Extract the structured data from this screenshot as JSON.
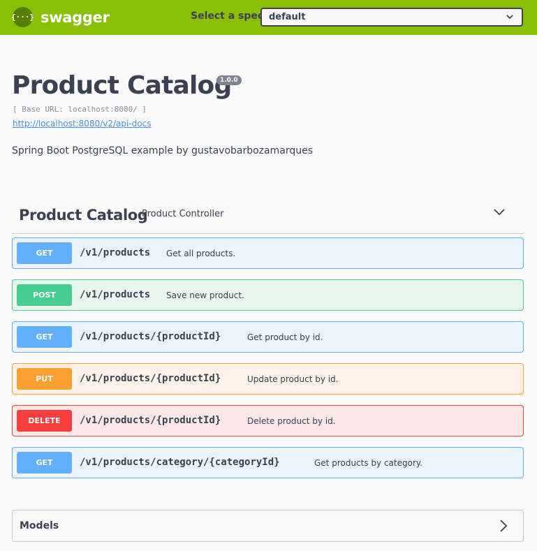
{
  "topbar": {
    "logo_symbol": "{···}",
    "logo_text": "swagger",
    "spec_label": "Select a spec",
    "spec_selected": "default",
    "background_color": "#89bf04"
  },
  "info": {
    "title": "Product Catalog",
    "version": "1.0.0",
    "base_url": "[ Base URL: localhost:8080/ ]",
    "docs_link": "http://localhost:8080/v2/api-docs",
    "description": "Spring Boot PostgreSQL example by gustavobarbozamarques"
  },
  "tag": {
    "name": "Product Catalog",
    "description": "Product Controller",
    "chevron_icon": "chevron-down-icon"
  },
  "operations": [
    {
      "method": "GET",
      "path": "/v1/products",
      "summary": "Get all products.",
      "color": "#61affe"
    },
    {
      "method": "POST",
      "path": "/v1/products",
      "summary": "Save new product.",
      "color": "#49cc90"
    },
    {
      "method": "GET",
      "path": "/v1/products/{productId}",
      "summary": "Get product by id.",
      "color": "#61affe"
    },
    {
      "method": "PUT",
      "path": "/v1/products/{productId}",
      "summary": "Update product by id.",
      "color": "#fca130"
    },
    {
      "method": "DELETE",
      "path": "/v1/products/{productId}",
      "summary": "Delete product by id.",
      "color": "#f93e3e"
    },
    {
      "method": "GET",
      "path": "/v1/products/category/{categoryId}",
      "summary": "Get products by category.",
      "color": "#61affe"
    }
  ],
  "models": {
    "label": "Models",
    "chevron_icon": "chevron-right-icon"
  }
}
